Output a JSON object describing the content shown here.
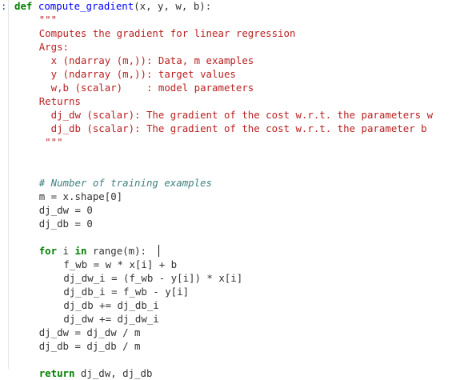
{
  "cell": {
    "prompt": ":",
    "code": {
      "def_keyword": "def",
      "function_name": "compute_gradient",
      "signature_rest": "(x, y, w, b):",
      "docstring": [
        "\"\"\"",
        "Computes the gradient for linear regression",
        "Args:",
        "  x (ndarray (m,)): Data, m examples",
        "  y (ndarray (m,)): target values",
        "  w,b (scalar)    : model parameters",
        "Returns",
        "  dj_dw (scalar): The gradient of the cost w.r.t. the parameters w",
        "  dj_db (scalar): The gradient of the cost w.r.t. the parameter b",
        " \"\"\""
      ],
      "comment": "# Number of training examples",
      "m_line": "m = x.shape[0]",
      "init_dw": "dj_dw = 0",
      "init_db": "dj_db = 0",
      "for_keyword": "for",
      "for_var": "i",
      "in_keyword": "in",
      "for_rest": "range(m):",
      "loop_body": [
        "f_wb = w * x[i] + b",
        "dj_dw_i = (f_wb - y[i]) * x[i]",
        "dj_db_i = f_wb - y[i]",
        "dj_db += dj_db_i",
        "dj_dw += dj_dw_i"
      ],
      "final_dw": "dj_dw = dj_dw / m",
      "final_db": "dj_db = dj_db / m",
      "return_keyword": "return",
      "return_values": "dj_dw, dj_db"
    }
  }
}
